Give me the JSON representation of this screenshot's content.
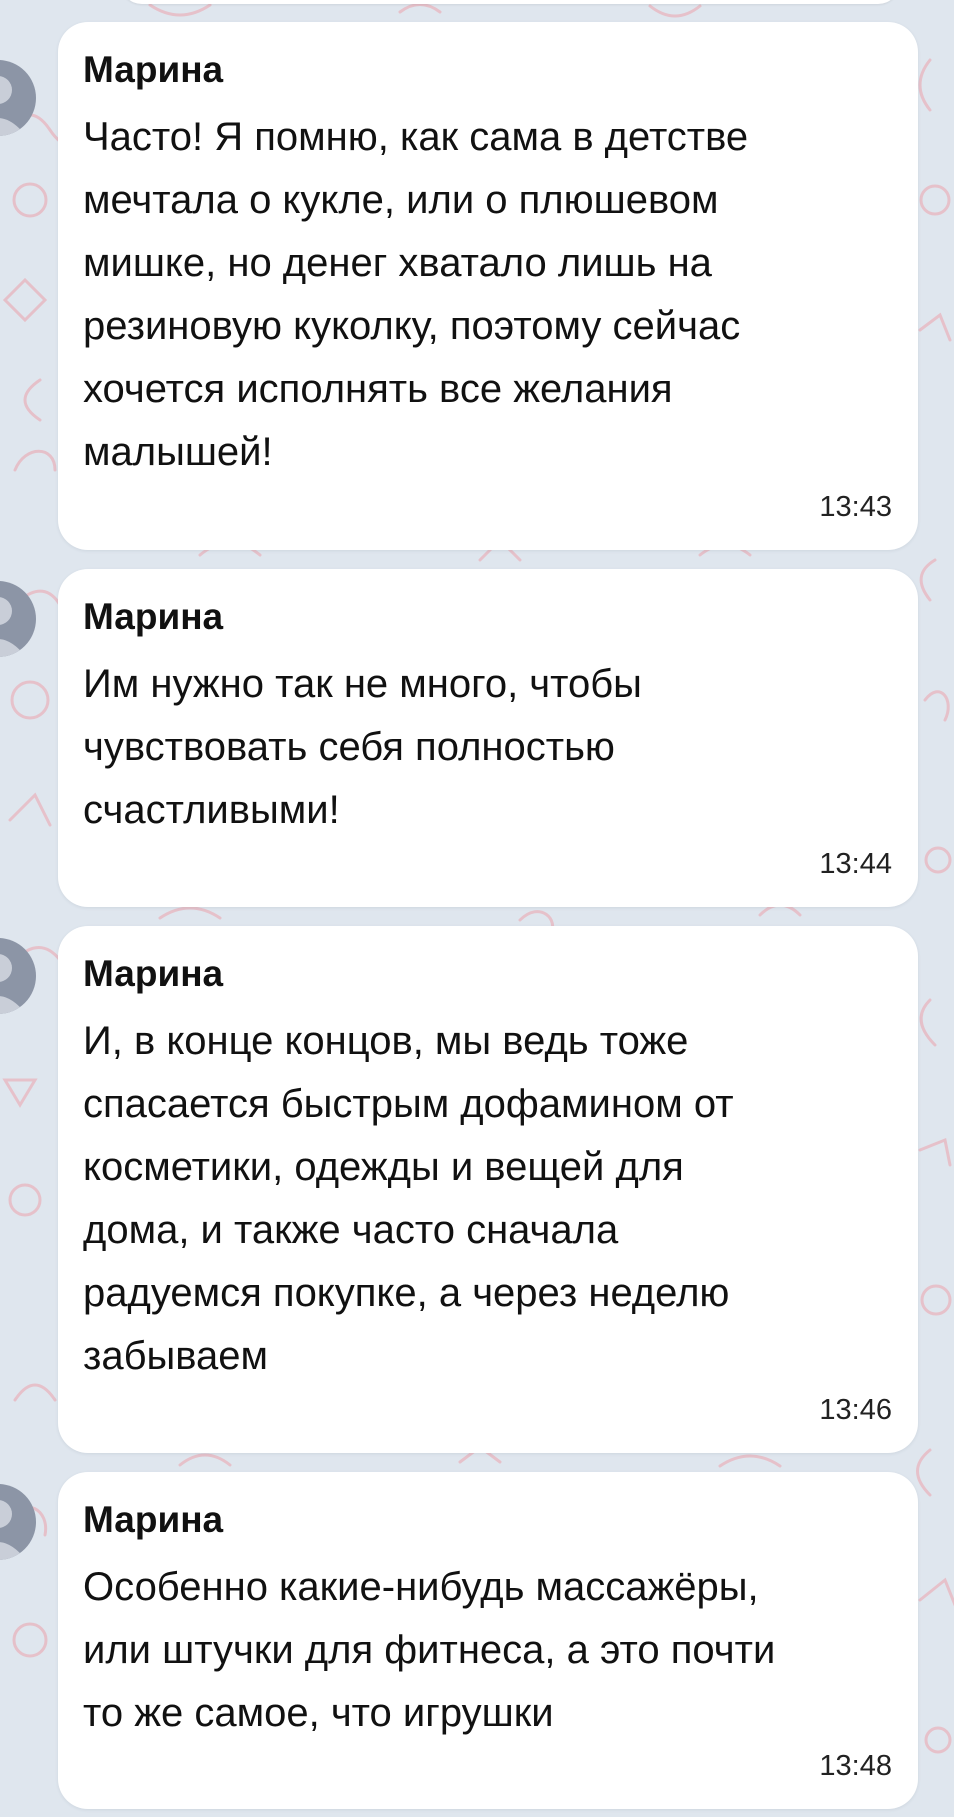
{
  "colors": {
    "background": "#dfe6ee",
    "bubble": "#ffffff",
    "text": "#111111",
    "wallpaper_doodles": "#e8b4bd",
    "avatar": "#8c95a6"
  },
  "messages": [
    {
      "sender": "Марина",
      "lines": [
        "Часто! Я помню, как сама в детстве",
        "мечтала о кукле, или о плюшевом",
        "мишке, но денег хватало лишь на",
        "резиновую куколку, поэтому сейчас",
        "хочется исполнять все желания",
        "малышей!"
      ],
      "time": "13:43"
    },
    {
      "sender": "Марина",
      "lines": [
        "Им нужно так не много, чтобы",
        "чувствовать себя полностью",
        "счастливыми!"
      ],
      "time": "13:44"
    },
    {
      "sender": "Марина",
      "lines": [
        "И, в конце концов, мы ведь тоже",
        "спасается быстрым дофамином от",
        "косметики, одежды и вещей для",
        "дома, и также часто сначала",
        "радуемся покупке, а через неделю",
        "забываем"
      ],
      "time": "13:46"
    },
    {
      "sender": "Марина",
      "lines": [
        "Особенно какие-нибудь массажёры,",
        "или штучки для фитнеса, а это почти",
        "то же самое, что игрушки"
      ],
      "time": "13:48"
    }
  ]
}
